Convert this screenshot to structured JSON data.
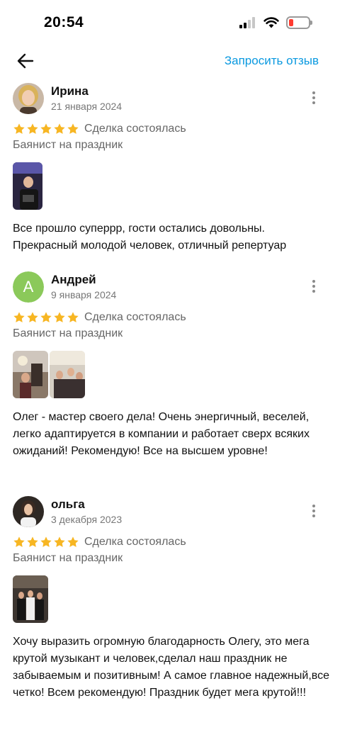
{
  "status_bar": {
    "time": "20:54"
  },
  "nav": {
    "request_label": "Запросить отзыв"
  },
  "colors": {
    "accent": "#0a99e0",
    "star": "#f7b623",
    "avatar_letter_bg": "#8bc95a"
  },
  "reviews": [
    {
      "author": "Ирина",
      "date": "21 января 2024",
      "rating": 5,
      "deal_status": "Сделка состоялась",
      "service": "Баянист на праздник",
      "text": "Все прошло суперрр, гости остались довольны. Прекрасный молодой человек, отличный репертуар"
    },
    {
      "author": "Андрей",
      "avatar_letter": "А",
      "date": "9 января 2024",
      "rating": 5,
      "deal_status": "Сделка состоялась",
      "service": "Баянист на праздник",
      "text": "Олег - мастер своего дела! Очень энергичный, веселей, легко адаптируется в компании и работает сверх всяких ожиданий! Рекомендую! Все на высшем уровне!"
    },
    {
      "author": "ольга",
      "date": "3 декабря 2023",
      "rating": 5,
      "deal_status": "Сделка состоялась",
      "service": "Баянист на праздник",
      "text": "Хочу выразить огромную благодарность  Олегу, это мега крутой музыкант и человек,сделал наш праздник не забываемым и позитивным! А самое главное надежный,все четко! Всем рекомендую! Праздник будет мега крутой!!!"
    }
  ]
}
